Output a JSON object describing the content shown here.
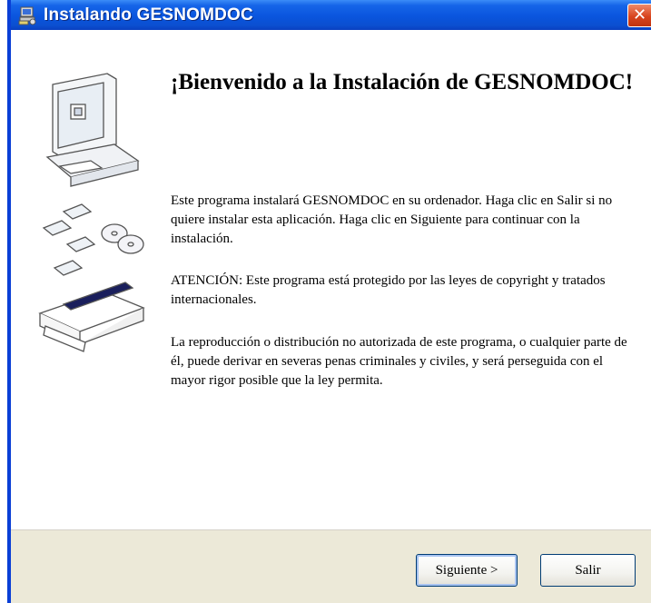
{
  "window": {
    "title": "Instalando GESNOMDOC",
    "icons": {
      "app": "installer-icon",
      "close": "close-icon",
      "art": "computer-disks-box-illustration"
    },
    "close_glyph": "✕",
    "colors": {
      "titlebar": "#0a55de",
      "close": "#d8451f",
      "footer": "#ece9d8"
    }
  },
  "content": {
    "heading": "¡Bienvenido a la Instalación de GESNOMDOC!",
    "paragraphs": [
      "Este programa instalará GESNOMDOC en su ordenador. Haga clic en Salir si no quiere instalar esta aplicación. Haga clic en Siguiente para continuar con la instalación.",
      "ATENCIÓN: Este programa está protegido por las leyes de copyright y tratados internacionales.",
      "La reproducción o distribución no autorizada de este programa, o cualquier parte de él, puede derivar en severas penas criminales y civiles, y será perseguida con el mayor rigor posible que la ley permita."
    ]
  },
  "buttons": {
    "next": "Siguiente >",
    "exit": "Salir"
  }
}
